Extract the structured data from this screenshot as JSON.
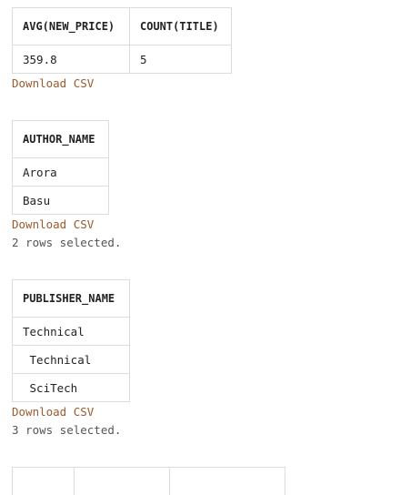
{
  "results": [
    {
      "columns": [
        "AVG(NEW_PRICE)",
        "COUNT(TITLE)"
      ],
      "rows": [
        [
          "359.8",
          "5"
        ]
      ],
      "download_label": "Download CSV",
      "status": ""
    },
    {
      "columns": [
        "AUTHOR_NAME"
      ],
      "rows": [
        [
          "Arora"
        ],
        [
          "Basu"
        ]
      ],
      "download_label": "Download CSV",
      "status": "2 rows selected."
    },
    {
      "columns": [
        "PUBLISHER_NAME"
      ],
      "rows": [
        [
          "Technical"
        ],
        [
          " Technical"
        ],
        [
          " SciTech"
        ]
      ],
      "download_label": "Download CSV",
      "status": "3 rows selected."
    }
  ],
  "colors": {
    "link": "#9a5a2e",
    "border": "#dcdcdc",
    "status": "#555555"
  }
}
